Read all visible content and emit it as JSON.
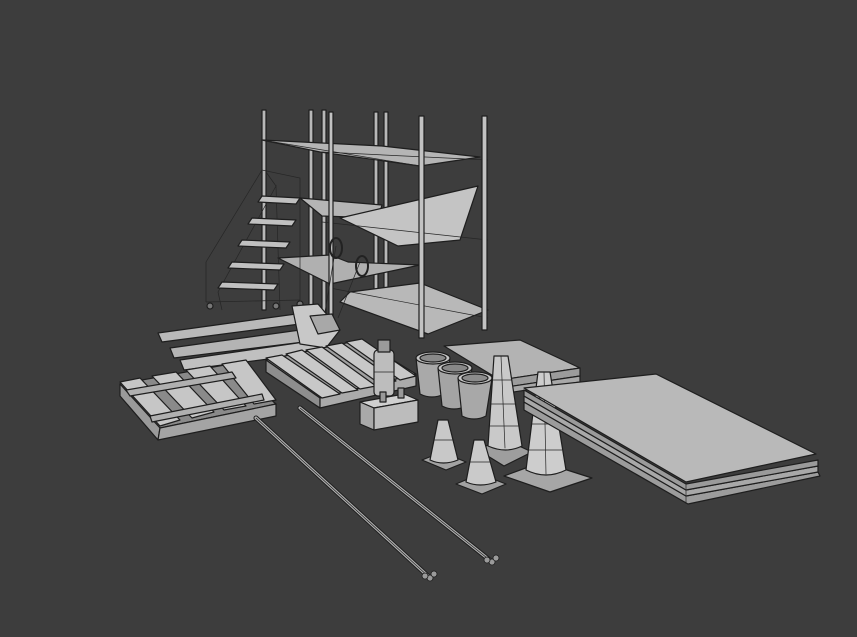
{
  "scene": {
    "background": "#3d3d3d",
    "shade_light": "#bdbdbd",
    "shade_mid": "#a6a6a6",
    "shade_dark": "#8a8a8a",
    "edge_color": "#1e1e1e",
    "objects": [
      "scaffold-shelving",
      "rolling-step-ladder",
      "pallet-jack",
      "wooden-pallet-left",
      "wooden-pallet-center",
      "gas-canister",
      "tool-crate",
      "paint-buckets",
      "traffic-cones",
      "metal-pipes",
      "plywood-sheet-stack-small",
      "plywood-sheet-stack-large"
    ]
  }
}
